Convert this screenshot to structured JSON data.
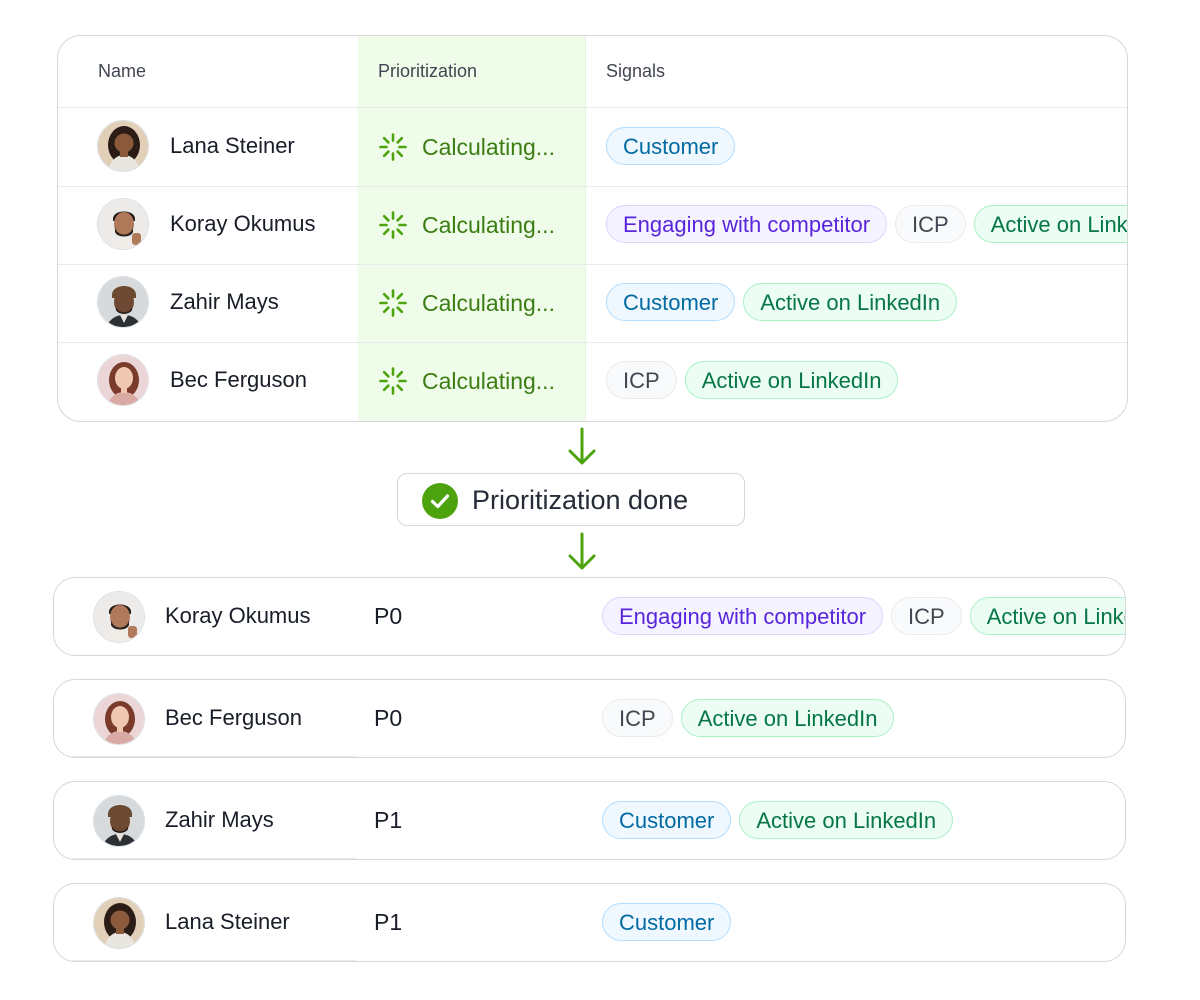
{
  "table": {
    "headers": {
      "name": "Name",
      "prioritization": "Prioritization",
      "signals": "Signals"
    },
    "calculating_label": "Calculating...",
    "rows": [
      {
        "name": "Lana Steiner",
        "signals": [
          {
            "label": "Customer",
            "kind": "customer"
          }
        ]
      },
      {
        "name": "Koray Okumus",
        "signals": [
          {
            "label": "Engaging with competitor",
            "kind": "competitor"
          },
          {
            "label": "ICP",
            "kind": "icp"
          },
          {
            "label": "Active on LinkedIn",
            "kind": "linkedin"
          }
        ]
      },
      {
        "name": "Zahir Mays",
        "signals": [
          {
            "label": "Customer",
            "kind": "customer"
          },
          {
            "label": "Active on LinkedIn",
            "kind": "linkedin"
          }
        ]
      },
      {
        "name": "Bec Ferguson",
        "signals": [
          {
            "label": "ICP",
            "kind": "icp"
          },
          {
            "label": "Active on LinkedIn",
            "kind": "linkedin"
          }
        ]
      }
    ]
  },
  "status": {
    "label": "Prioritization done",
    "icon": "check-circle-icon"
  },
  "results": [
    {
      "name": "Koray Okumus",
      "priority": "P0",
      "signals": [
        {
          "label": "Engaging with competitor",
          "kind": "competitor"
        },
        {
          "label": "ICP",
          "kind": "icp"
        },
        {
          "label": "Active on LinkedIn",
          "kind": "linkedin"
        }
      ]
    },
    {
      "name": "Bec Ferguson",
      "priority": "P0",
      "signals": [
        {
          "label": "ICP",
          "kind": "icp"
        },
        {
          "label": "Active on LinkedIn",
          "kind": "linkedin"
        }
      ]
    },
    {
      "name": "Zahir Mays",
      "priority": "P1",
      "signals": [
        {
          "label": "Customer",
          "kind": "customer"
        },
        {
          "label": "Active on LinkedIn",
          "kind": "linkedin"
        }
      ]
    },
    {
      "name": "Lana Steiner",
      "priority": "P1",
      "signals": [
        {
          "label": "Customer",
          "kind": "customer"
        }
      ]
    }
  ],
  "colors": {
    "accent_green": "#4ca30d",
    "calculating_text": "#3b7d13",
    "prioritization_column_bg": "#f0fcea"
  }
}
